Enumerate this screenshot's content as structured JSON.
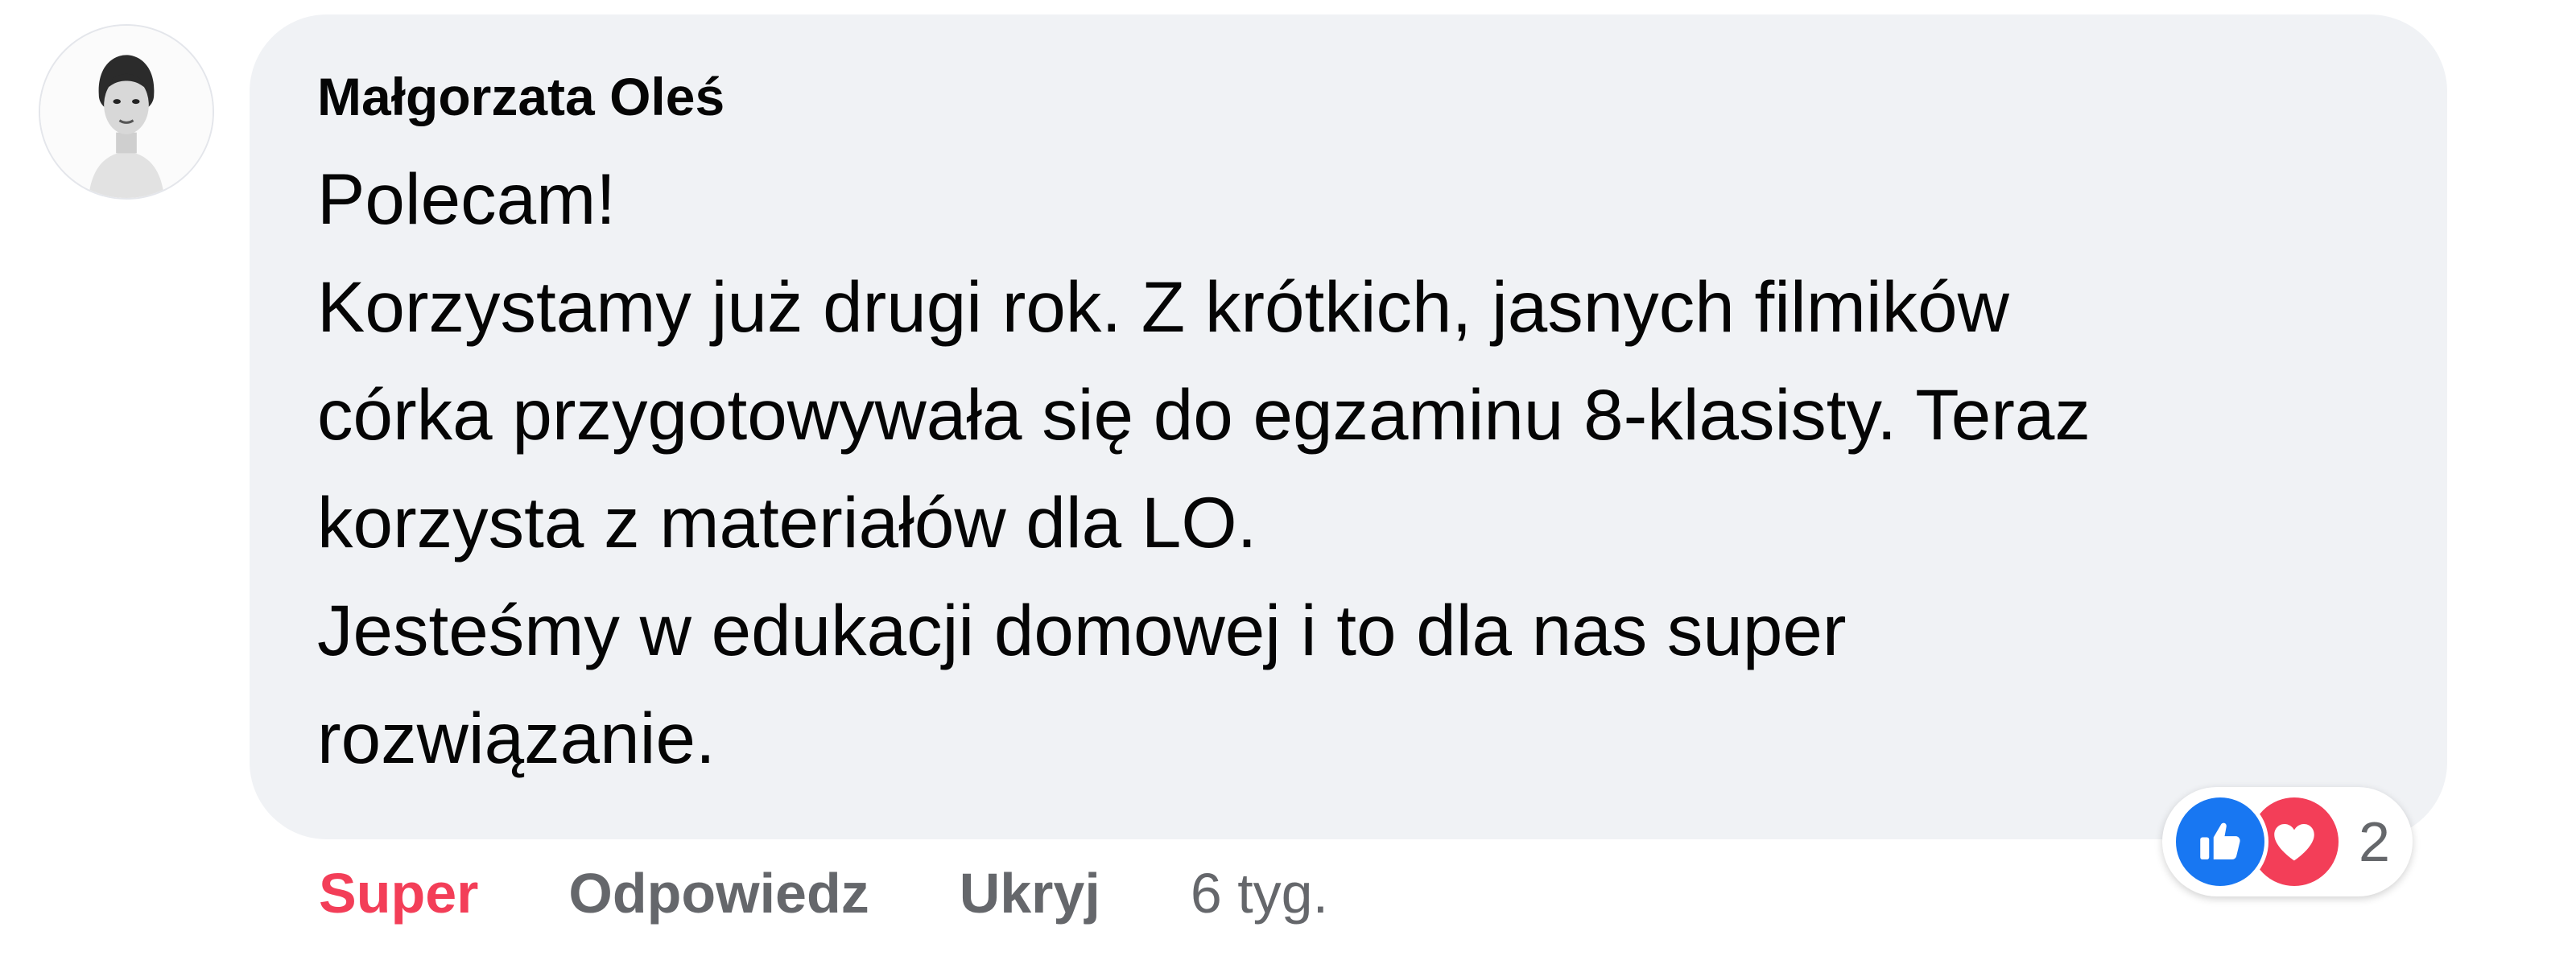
{
  "comment": {
    "author": "Małgorzata Oleś",
    "text_lines": [
      "Polecam!",
      "Korzystamy już drugi rok. Z krótkich, jasnych filmików",
      "córka przygotowywała się do egzaminu 8-klasisty. Teraz",
      "korzysta z materiałów dla LO.",
      "Jesteśmy w edukacji domowej i to dla nas super",
      "rozwiązanie."
    ],
    "bubble_color": "#f0f2f5"
  },
  "actions": {
    "reaction_label": "Super",
    "reaction_color": "#f33e58",
    "reply_label": "Odpowiedz",
    "hide_label": "Ukryj",
    "time": "6 tyg."
  },
  "reactions": {
    "icons": [
      "like-icon",
      "love-icon"
    ],
    "like_color": "#1877f2",
    "love_color": "#f33e58",
    "count": "2"
  }
}
